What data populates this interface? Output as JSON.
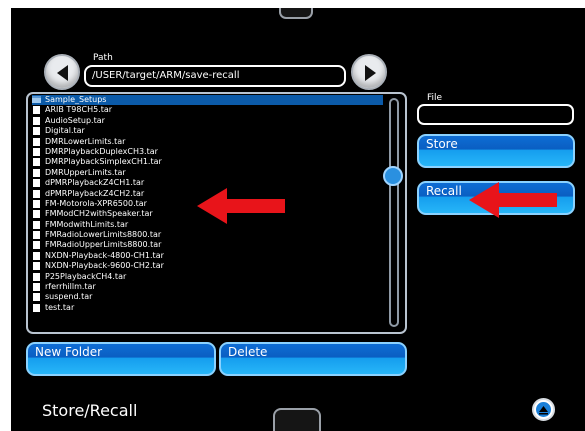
{
  "path": {
    "label": "Path",
    "value": "/USER/target/ARM/save-recall"
  },
  "file_list": [
    {
      "name": "Sample_Setups",
      "type": "folder",
      "selected": true
    },
    {
      "name": "ARIB T98CH5.tar",
      "type": "file"
    },
    {
      "name": "AudioSetup.tar",
      "type": "file"
    },
    {
      "name": "Digital.tar",
      "type": "file"
    },
    {
      "name": "DMRLowerLimits.tar",
      "type": "file"
    },
    {
      "name": "DMRPlaybackDuplexCH3.tar",
      "type": "file"
    },
    {
      "name": "DMRPlaybackSimplexCH1.tar",
      "type": "file"
    },
    {
      "name": "DMRUpperLimits.tar",
      "type": "file"
    },
    {
      "name": "dPMRPlaybackZ4CH1.tar",
      "type": "file"
    },
    {
      "name": "dPMRPlaybackZ4CH2.tar",
      "type": "file"
    },
    {
      "name": "FM-Motorola-XPR6500.tar",
      "type": "file"
    },
    {
      "name": "FMModCH2withSpeaker.tar",
      "type": "file"
    },
    {
      "name": "FMModwithLimits.tar",
      "type": "file"
    },
    {
      "name": "FMRadioLowerLimits8800.tar",
      "type": "file"
    },
    {
      "name": "FMRadioUpperLimits8800.tar",
      "type": "file"
    },
    {
      "name": "NXDN-Playback-4800-CH1.tar",
      "type": "file"
    },
    {
      "name": "NXDN-Playback-9600-CH2.tar",
      "type": "file"
    },
    {
      "name": "P25PlaybackCH4.tar",
      "type": "file"
    },
    {
      "name": "rferrhillm.tar",
      "type": "file"
    },
    {
      "name": "suspend.tar",
      "type": "file"
    },
    {
      "name": "test.tar",
      "type": "file"
    }
  ],
  "file": {
    "label": "File",
    "value": ""
  },
  "buttons": {
    "store": "Store",
    "recall": "Recall",
    "new_folder": "New Folder",
    "delete": "Delete"
  },
  "page_title": "Store/Recall",
  "colors": {
    "background": "#000000",
    "accent_blue": "#1a8fe8",
    "selection": "#0b5aa8",
    "annotation_arrow": "#e8141a"
  },
  "icons": {
    "back": "chevron-left-icon",
    "forward": "chevron-right-icon",
    "menu": "chevron-up-icon"
  }
}
